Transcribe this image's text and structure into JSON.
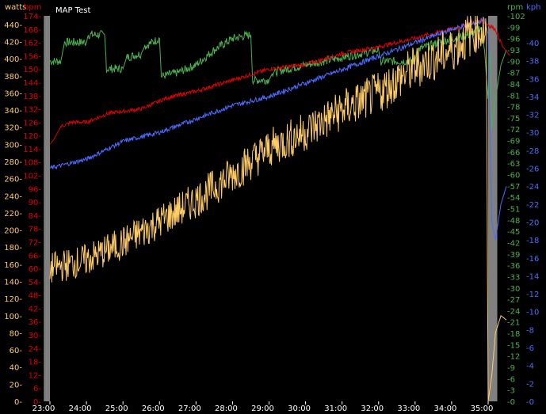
{
  "title": "MAP Test",
  "colors": {
    "background": "#000000",
    "shade": "#808080",
    "watts": "#ffcc66",
    "bpm": "#e00000",
    "rpm": "#4caf50",
    "kph": "#4a6cff",
    "x_axis": "#ffffff"
  },
  "chart_data": {
    "type": "line",
    "title": "MAP Test",
    "x_ticks": [
      "23:00",
      "24:00",
      "25:00",
      "26:00",
      "27:00",
      "28:00",
      "29:00",
      "30:00",
      "31:00",
      "32:00",
      "33:00",
      "34:00",
      "35:00"
    ],
    "shaded_regions": [
      {
        "from": "22:50",
        "to": "23:00"
      },
      {
        "from": "34:60",
        "to": "35:15"
      }
    ],
    "axes": {
      "watts": {
        "label": "watts",
        "side": "left",
        "ylim": [
          0,
          450
        ],
        "ticks": [
          "0",
          "20",
          "40",
          "60",
          "80",
          "100",
          "120",
          "140",
          "160",
          "180",
          "200",
          "220",
          "240",
          "260",
          "280",
          "300",
          "320",
          "340",
          "360",
          "380",
          "400",
          "420",
          "440"
        ]
      },
      "bpm": {
        "label": "bpm",
        "side": "left",
        "ylim": [
          0,
          174
        ],
        "ticks": [
          "0",
          "6",
          "12",
          "18",
          "24",
          "30",
          "36",
          "42",
          "48",
          "54",
          "60",
          "66",
          "72",
          "78",
          "84",
          "90",
          "96",
          "102",
          "108",
          "114",
          "120",
          "126",
          "132",
          "138",
          "144",
          "150",
          "156",
          "162",
          "168",
          "174"
        ]
      },
      "rpm": {
        "label": "rpm",
        "side": "right",
        "ylim": [
          0,
          102
        ],
        "ticks": [
          "0",
          "3",
          "6",
          "9",
          "12",
          "15",
          "18",
          "21",
          "24",
          "27",
          "30",
          "33",
          "36",
          "39",
          "42",
          "45",
          "48",
          "51",
          "54",
          "57",
          "60",
          "63",
          "66",
          "69",
          "72",
          "75",
          "78",
          "81",
          "84",
          "87",
          "90",
          "93",
          "96",
          "99",
          "102"
        ]
      },
      "kph": {
        "label": "kph",
        "side": "right",
        "ylim": [
          0,
          43
        ],
        "ticks": [
          "0",
          "2",
          "4",
          "6",
          "8",
          "10",
          "12",
          "14",
          "16",
          "18",
          "20",
          "22",
          "24",
          "26",
          "28",
          "30",
          "32",
          "34",
          "36",
          "38",
          "40"
        ]
      }
    },
    "series": [
      {
        "name": "watts",
        "axis": "watts",
        "noise": 14,
        "points": [
          [
            0,
            155
          ],
          [
            1,
            165
          ],
          [
            2,
            185
          ],
          [
            3,
            210
          ],
          [
            4,
            235
          ],
          [
            5,
            265
          ],
          [
            6,
            295
          ],
          [
            7,
            315
          ],
          [
            8,
            340
          ],
          [
            9,
            360
          ],
          [
            10,
            390
          ],
          [
            11,
            410
          ],
          [
            11.7,
            435
          ],
          [
            11.95,
            430
          ],
          [
            12.0,
            0
          ],
          [
            12.1,
            30
          ],
          [
            12.2,
            80
          ],
          [
            12.35,
            100
          ],
          [
            12.5,
            95
          ]
        ]
      },
      {
        "name": "bpm",
        "axis": "bpm",
        "noise": 0.5,
        "points": [
          [
            0,
            116
          ],
          [
            0.1,
            118
          ],
          [
            0.3,
            124
          ],
          [
            0.6,
            126
          ],
          [
            1,
            126
          ],
          [
            1.6,
            130
          ],
          [
            2.5,
            132
          ],
          [
            3.2,
            137
          ],
          [
            4,
            140
          ],
          [
            5,
            145
          ],
          [
            6,
            150
          ],
          [
            7,
            152
          ],
          [
            8,
            157
          ],
          [
            9,
            160
          ],
          [
            10,
            164
          ],
          [
            11,
            168
          ],
          [
            11.8,
            172
          ],
          [
            12.2,
            168
          ],
          [
            12.4,
            160
          ],
          [
            12.6,
            156
          ]
        ]
      },
      {
        "name": "rpm",
        "axis": "rpm",
        "noise": 0.6,
        "points": [
          [
            0,
            90
          ],
          [
            0.3,
            90
          ],
          [
            0.4,
            95
          ],
          [
            1.0,
            95
          ],
          [
            1.05,
            97
          ],
          [
            1.5,
            97
          ],
          [
            1.55,
            88
          ],
          [
            2.0,
            88
          ],
          [
            2.1,
            91
          ],
          [
            2.5,
            92
          ],
          [
            2.6,
            94
          ],
          [
            3.0,
            96
          ],
          [
            3.05,
            86
          ],
          [
            3.5,
            87
          ],
          [
            4.0,
            89
          ],
          [
            4.5,
            93
          ],
          [
            5.0,
            96
          ],
          [
            5.5,
            97
          ],
          [
            5.55,
            85
          ],
          [
            6.0,
            85
          ],
          [
            6.1,
            87
          ],
          [
            7.0,
            89
          ],
          [
            8.0,
            91
          ],
          [
            9.0,
            93
          ],
          [
            9.05,
            90
          ],
          [
            10.0,
            90
          ],
          [
            10.05,
            93
          ],
          [
            11.0,
            96
          ],
          [
            11.5,
            97
          ],
          [
            11.8,
            99
          ],
          [
            11.9,
            93
          ],
          [
            12.0,
            80
          ],
          [
            12.05,
            93
          ],
          [
            12.1,
            72
          ],
          [
            12.2,
            80
          ],
          [
            12.35,
            89
          ],
          [
            12.5,
            93
          ]
        ]
      },
      {
        "name": "kph",
        "axis": "kph",
        "noise": 0.15,
        "points": [
          [
            0,
            26
          ],
          [
            1,
            27
          ],
          [
            2,
            29
          ],
          [
            3,
            30
          ],
          [
            4,
            31.5
          ],
          [
            5,
            33
          ],
          [
            6,
            34
          ],
          [
            7,
            35.5
          ],
          [
            8,
            37
          ],
          [
            9,
            38.5
          ],
          [
            10,
            40
          ],
          [
            11,
            41.5
          ],
          [
            11.9,
            42.5
          ],
          [
            12.0,
            41
          ],
          [
            12.1,
            20
          ],
          [
            12.2,
            18
          ],
          [
            12.35,
            22
          ],
          [
            12.5,
            24
          ]
        ]
      }
    ]
  }
}
